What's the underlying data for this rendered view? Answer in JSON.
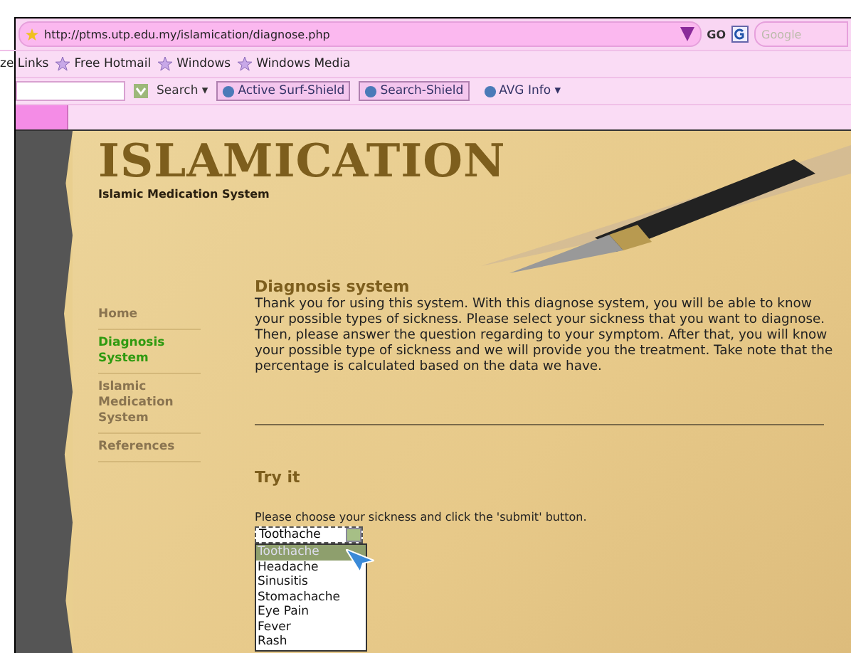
{
  "browser": {
    "url": "http://ptms.utp.edu.my/islamication/diagnose.php",
    "go_label": "GO",
    "search_placeholder": "Google",
    "links": [
      "ze Links",
      "Free Hotmail",
      "Windows",
      "Windows Media"
    ],
    "toolbar": {
      "search_label": "Search",
      "caret": "▾",
      "buttons": [
        "Active Surf-Shield",
        "Search-Shield",
        "AVG Info"
      ]
    }
  },
  "site": {
    "title": "ISLAMICATION",
    "subtitle": "Islamic Medication System",
    "nav": [
      {
        "label": "Home",
        "selected": false
      },
      {
        "label": "Diagnosis System",
        "selected": true
      },
      {
        "label": "Islamic Medication System",
        "selected": false
      },
      {
        "label": "References",
        "selected": false
      }
    ],
    "heading": "Diagnosis system",
    "intro": "Thank you for using this system. With this diagnose system, you will be able to know your possible types of sickness. Please select your sickness that you want to diagnose. Then, please answer the question regarding to your symptom. After that, you will know your possible type of sickness and we will provide you the treatment. Take note that the percentage is calculated based on the data we have.",
    "try_heading": "Try it",
    "prompt": "Please choose your sickness and click the 'submit' button.",
    "select": {
      "value": "Toothache",
      "options": [
        {
          "label": "Toothache",
          "selected": true
        },
        {
          "label": "Headache",
          "selected": false
        },
        {
          "label": "Sinusitis",
          "selected": false
        },
        {
          "label": "Stomachache",
          "selected": false
        },
        {
          "label": "Eye Pain",
          "selected": false
        },
        {
          "label": "Fever",
          "selected": false
        },
        {
          "label": "Rash",
          "selected": false
        }
      ]
    }
  }
}
